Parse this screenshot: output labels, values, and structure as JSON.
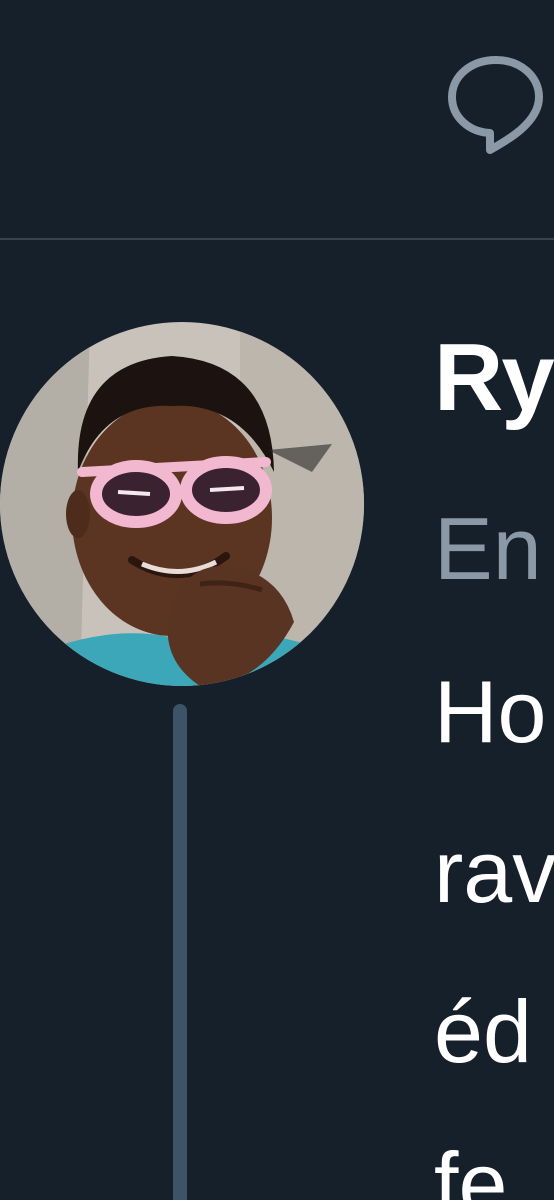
{
  "toolbar": {
    "reply_icon": "speech-bubble-icon"
  },
  "tweet": {
    "author": {
      "display_name": "Ry",
      "handle": "En",
      "avatar": "profile-photo-person-with-pink-sunglasses"
    },
    "text_lines": [
      "Ho",
      "rav",
      "éd",
      "fe"
    ]
  },
  "colors": {
    "background": "#15202b",
    "divider": "#38444d",
    "thread_line": "#3d5466",
    "primary_text": "#ffffff",
    "secondary_text": "#8b98a5",
    "icon": "#8b98a5"
  }
}
